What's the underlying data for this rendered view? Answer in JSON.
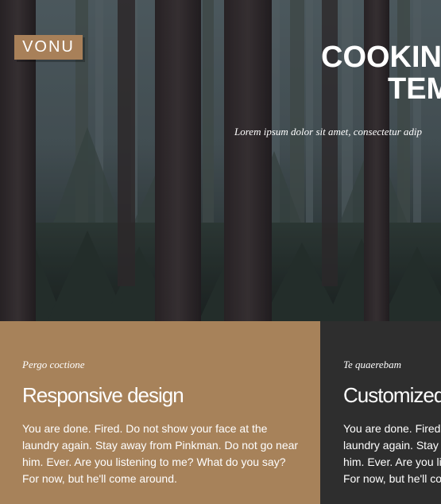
{
  "logo": {
    "text": "VONU"
  },
  "hero": {
    "title_line1": "COOKIN",
    "title_line2": "TEM",
    "subtitle": "Lorem ipsum dolor sit amet, consectetur adip"
  },
  "features": [
    {
      "kicker": "Pergo coctione",
      "heading": "Responsive design",
      "body": "You are done. Fired. Do not show your face at the laundry again. Stay away from Pinkman. Do not go near him. Ever. Are you listening to me? What do you say? For now, but he'll come around."
    },
    {
      "kicker": "Te quaerebam",
      "heading": "Customized",
      "body": "You are done. Fired. Do not show your face at the laundry again. Stay away from Pinkman. Do not go near him. Ever. Are you listening to me? What do you say? For now, but he'll come around."
    }
  ],
  "colors": {
    "accent_tan": "#a7825a",
    "dark_panel": "#2e2e2e",
    "text": "#ffffff"
  }
}
